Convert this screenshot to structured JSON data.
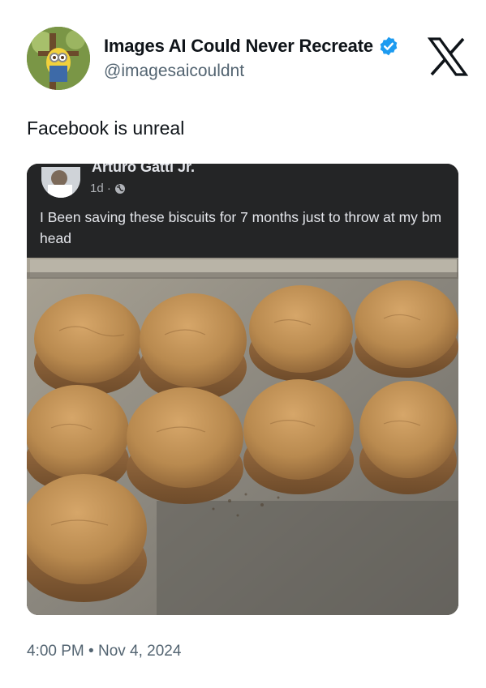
{
  "author": {
    "display_name": "Images AI Could Never Recreate",
    "handle": "@imagesaicouldnt",
    "verified_icon": "verified-badge-icon",
    "avatar": "avatar-image"
  },
  "platform_logo": "x-logo-icon",
  "tweet": {
    "text": "Facebook is unreal",
    "timestamp": "4:00 PM • Nov 4, 2024"
  },
  "embedded_post": {
    "author_name": "Arturo Gatti Jr.",
    "time": "1d ·",
    "audience_icon": "globe-icon",
    "text": "I Been saving these biscuits for 7 months just to throw at my bm head",
    "photo": "biscuits-on-baking-tray-photo"
  },
  "colors": {
    "verified_blue": "#1d9bf0",
    "text_primary": "#0f1419",
    "text_secondary": "#536471",
    "fb_background": "#242526"
  }
}
